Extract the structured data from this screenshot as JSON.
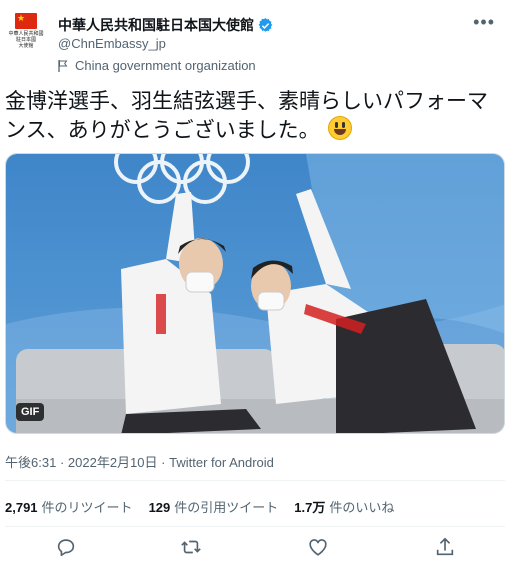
{
  "account": {
    "display_name": "中華人民共和国駐日本国大使館",
    "handle": "@ChnEmbassy_jp",
    "label": "China government organization",
    "avatar_text": "中華人民共和國\n駐日本國\n大使館",
    "verified_color": "#1d9bf0"
  },
  "tweet": {
    "text": "金博洋選手、羽生結弦選手、素晴らしいパフォーマンス、ありがとうございました。",
    "emoji": "smiley-face-emoji",
    "media_badge": "GIF"
  },
  "meta": {
    "time": "午後6:31",
    "date": "2022年2月10日",
    "source": "Twitter for Android",
    "separator": "·"
  },
  "stats": {
    "retweets_count": "2,791",
    "retweets_label": "件のリツイート",
    "quotes_count": "129",
    "quotes_label": "件の引用ツイート",
    "likes_count": "1.7万",
    "likes_label": "件のいいね"
  },
  "actions": {
    "reply": "reply-icon",
    "retweet": "retweet-icon",
    "like": "heart-icon",
    "share": "share-icon"
  },
  "colors": {
    "text": "#0f1419",
    "secondary": "#536471",
    "divider": "#eff3f4",
    "flag_red": "#de2910"
  }
}
